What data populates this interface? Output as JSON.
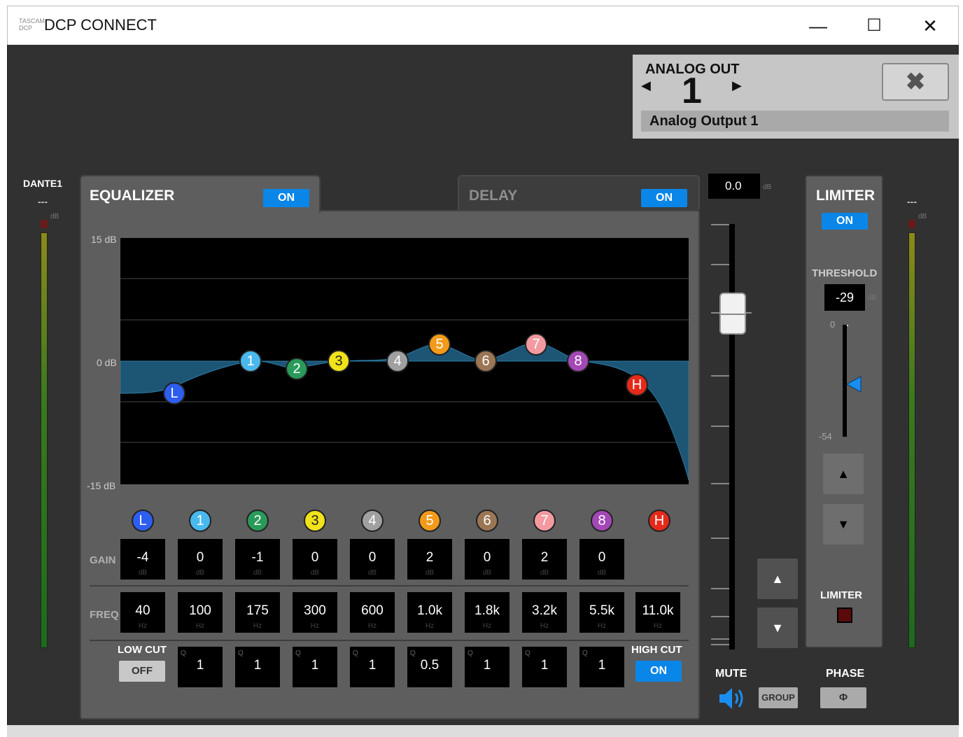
{
  "window": {
    "logo_text": "TASCAM DCP",
    "title": "DCP CONNECT",
    "minimize_glyph": "—",
    "maximize_glyph": "☐",
    "close_glyph": "✕"
  },
  "channel": {
    "type": "ANALOG OUT",
    "number": "1",
    "name": "Analog Output 1",
    "prev_glyph": "◀",
    "next_glyph": "▶",
    "close_glyph": "✖"
  },
  "input_meter": {
    "label": "DANTE1",
    "value": "---",
    "unit": "dB"
  },
  "output_meter": {
    "value": "---",
    "unit": "dB"
  },
  "equalizer": {
    "title": "EQUALIZER",
    "on_label": "ON",
    "y_labels": {
      "top": "15 dB",
      "mid": "0 dB",
      "bottom": "-15 dB"
    },
    "gain_label": "GAIN",
    "freq_label": "FREQ",
    "low_cut": {
      "label": "LOW CUT",
      "state": "OFF"
    },
    "high_cut": {
      "label": "HIGH CUT",
      "state": "ON"
    },
    "bands": [
      {
        "id": "L",
        "color": "#2e5ef0",
        "gain": "-4",
        "gain_unit": "dB",
        "freq": "40",
        "freq_unit": "Hz"
      },
      {
        "id": "1",
        "color": "#49b8ec",
        "gain": "0",
        "gain_unit": "dB",
        "freq": "100",
        "freq_unit": "Hz",
        "q": "1"
      },
      {
        "id": "2",
        "color": "#2a9a5a",
        "gain": "-1",
        "gain_unit": "dB",
        "freq": "175",
        "freq_unit": "Hz",
        "q": "1"
      },
      {
        "id": "3",
        "color": "#f1e21a",
        "gain": "0",
        "gain_unit": "dB",
        "freq": "300",
        "freq_unit": "Hz",
        "q": "1"
      },
      {
        "id": "4",
        "color": "#a0a0a0",
        "gain": "0",
        "gain_unit": "dB",
        "freq": "600",
        "freq_unit": "Hz",
        "q": "1"
      },
      {
        "id": "5",
        "color": "#f39a1a",
        "gain": "2",
        "gain_unit": "dB",
        "freq": "1.0k",
        "freq_unit": "Hz",
        "q": "0.5"
      },
      {
        "id": "6",
        "color": "#9b7655",
        "gain": "0",
        "gain_unit": "dB",
        "freq": "1.8k",
        "freq_unit": "Hz",
        "q": "1"
      },
      {
        "id": "7",
        "color": "#f39aa0",
        "gain": "2",
        "gain_unit": "dB",
        "freq": "3.2k",
        "freq_unit": "Hz",
        "q": "1"
      },
      {
        "id": "8",
        "color": "#a448b6",
        "gain": "0",
        "gain_unit": "dB",
        "freq": "5.5k",
        "freq_unit": "Hz",
        "q": "1"
      },
      {
        "id": "H",
        "color": "#e42a1a",
        "freq": "11.0k",
        "freq_unit": "Hz"
      }
    ],
    "q_label": "Q"
  },
  "delay": {
    "title": "DELAY",
    "on_label": "ON"
  },
  "fader": {
    "value": "0.0",
    "unit": "dB",
    "up_glyph": "▲",
    "down_glyph": "▼"
  },
  "limiter": {
    "title": "LIMITER",
    "on_label": "ON",
    "threshold_label": "THRESHOLD",
    "threshold_value": "-29",
    "threshold_unit": "dB",
    "scale_max": "0",
    "scale_min": "-54",
    "up_glyph": "▲",
    "down_glyph": "▼",
    "indicator_label": "LIMITER"
  },
  "mute": {
    "label": "MUTE",
    "icon": "speaker-icon"
  },
  "group": {
    "label": "GROUP"
  },
  "phase": {
    "label": "PHASE",
    "glyph": "Φ"
  }
}
